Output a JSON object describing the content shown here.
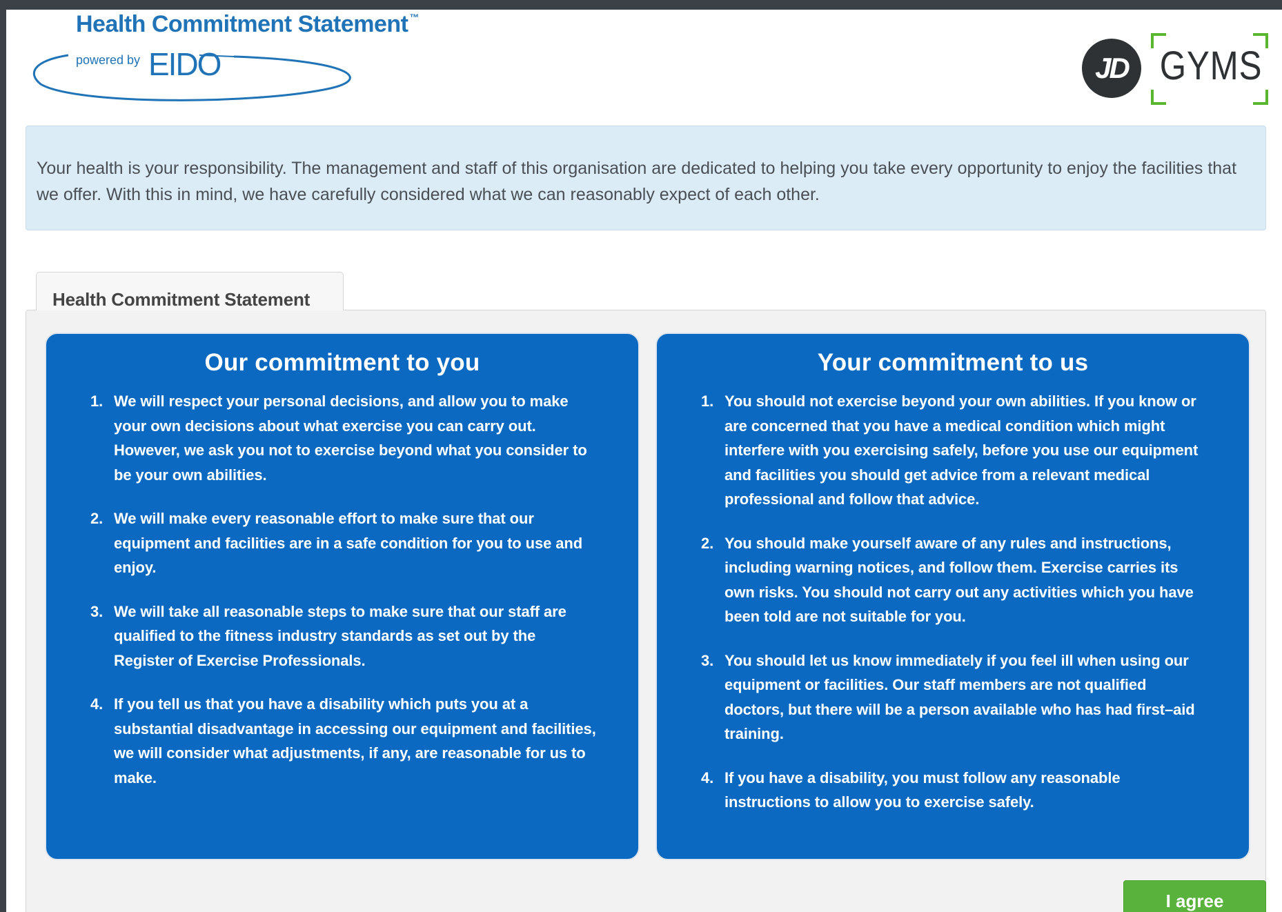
{
  "header": {
    "brand_title": "Health Commitment Statement",
    "brand_trademark": "™",
    "brand_powered_by": "powered by",
    "brand_provider": "EIDO",
    "partner_logo_mark": "JD",
    "partner_logo_text": "GYMS"
  },
  "intro": {
    "text": "Your health is your responsibility. The management and staff of this organisation are dedicated to helping you take every opportunity to enjoy the facilities that we offer. With this in mind, we have carefully considered what we can reasonably expect of each other."
  },
  "tabs": [
    {
      "label": "Health Commitment Statement",
      "active": true
    }
  ],
  "our_commitment": {
    "title": "Our commitment to you",
    "items": [
      {
        "num": "1.",
        "text": "We will respect your personal decisions, and allow you to make your own decisions about what exercise you can carry out. However, we ask you not to exercise beyond what you consider to be your own abilities."
      },
      {
        "num": "2.",
        "text": "We will make every reasonable effort to make sure that our equipment and facilities are in a safe condition for you to use and enjoy."
      },
      {
        "num": "3.",
        "text": "We will take all reasonable steps to make sure that our staff are qualified to the fitness industry standards as set out by the Register of Exercise Professionals."
      },
      {
        "num": "4.",
        "text": "If you tell us that you have a disability which puts you at a substantial disadvantage in accessing our equipment and facilities, we will consider what adjustments, if any, are reasonable for us to make."
      }
    ]
  },
  "your_commitment": {
    "title": "Your commitment to us",
    "items": [
      {
        "num": "1.",
        "text": "You should not exercise beyond your own abilities. If you know or are concerned that you have a medical condition which might interfere with you exercising safely, before you use our equipment and facilities you should get advice from a relevant medical professional and follow that advice."
      },
      {
        "num": "2.",
        "text": "You should make yourself aware of any rules and instructions, including warning notices, and follow them. Exercise carries its own risks. You should not carry out any activities which you have been told are not suitable for you."
      },
      {
        "num": "3.",
        "text": "You should let us know immediately if you feel ill when using our equipment or facilities. Our staff members are not qualified doctors, but there will be a person available who has had first–aid training."
      },
      {
        "num": "4.",
        "text": "If you have a disability, you must follow any reasonable instructions to allow you to exercise safely."
      }
    ]
  },
  "actions": {
    "agree_label": "I agree"
  },
  "colors": {
    "brand_blue": "#1f73b6",
    "box_blue": "#0b69c1",
    "intro_bg": "#dcecf7",
    "agree_green": "#59b23c",
    "logo_corner_green": "#5ab52f",
    "frame": "#3b4147"
  }
}
